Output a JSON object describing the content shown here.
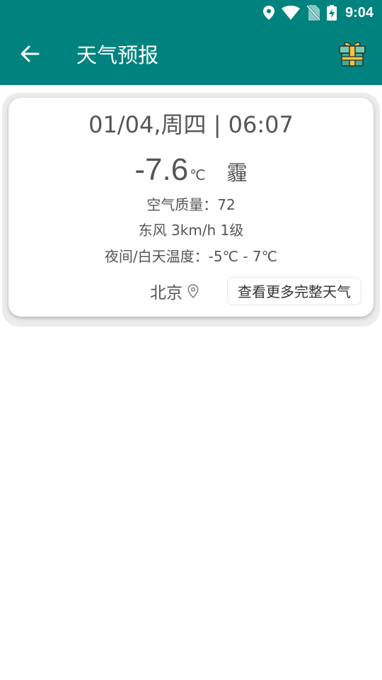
{
  "status_bar": {
    "time": "9:04",
    "icons": [
      "location-icon",
      "wifi-icon",
      "no-sim-icon",
      "battery-charging-icon"
    ]
  },
  "app_bar": {
    "title": "天气预报",
    "back_icon": "arrow-left-icon",
    "gift_icon": "gift-box-icon",
    "background_color": "#00837e"
  },
  "weather": {
    "date_time": "01/04,周四 | 06:07",
    "temperature": "-7.6",
    "temperature_unit": "℃",
    "condition": "霾",
    "air_quality": "空气质量：72",
    "wind": "东风 3km/h 1级",
    "temp_range": "夜间/白天温度：-5℃ - 7℃",
    "city": "北京",
    "location_icon": "map-pin-icon",
    "more_button_label": "查看更多完整天气"
  }
}
